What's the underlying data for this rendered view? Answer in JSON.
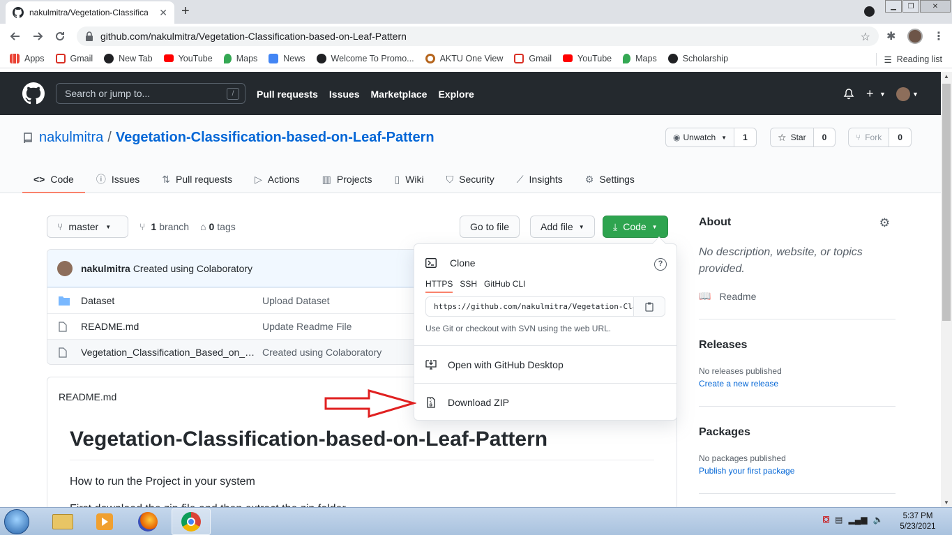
{
  "browser": {
    "tab_title": "nakulmitra/Vegetation-Classification-based-on-Leaf-Pattern",
    "tab_close": "✕",
    "new_tab": "+",
    "url": "github.com/nakulmitra/Vegetation-Classification-based-on-Leaf-Pattern",
    "bookmarks": [
      {
        "label": "Apps",
        "icon": "apps-grid-icon",
        "color": "#4285f4"
      },
      {
        "label": "Gmail",
        "icon": "gmail-icon",
        "color": "#d93025"
      },
      {
        "label": "New Tab",
        "icon": "globe-icon",
        "color": "#202124"
      },
      {
        "label": "YouTube",
        "icon": "youtube-icon",
        "color": "#ff0000"
      },
      {
        "label": "Maps",
        "icon": "maps-icon",
        "color": "#34a853"
      },
      {
        "label": "News",
        "icon": "news-icon",
        "color": "#4285f4"
      },
      {
        "label": "Welcome To Promo...",
        "icon": "globe-icon",
        "color": "#202124"
      },
      {
        "label": "AKTU One View",
        "icon": "seal-icon",
        "color": "#b5651d"
      },
      {
        "label": "Gmail",
        "icon": "gmail-icon",
        "color": "#d93025"
      },
      {
        "label": "YouTube",
        "icon": "youtube-icon",
        "color": "#ff0000"
      },
      {
        "label": "Maps",
        "icon": "maps-icon",
        "color": "#34a853"
      },
      {
        "label": "Scholarship",
        "icon": "globe-icon",
        "color": "#202124"
      }
    ],
    "reading_list": "Reading list"
  },
  "github_header": {
    "search_placeholder": "Search or jump to...",
    "search_shortcut": "/",
    "nav": [
      "Pull requests",
      "Issues",
      "Marketplace",
      "Explore"
    ]
  },
  "repo": {
    "owner": "nakulmitra",
    "separator": "/",
    "name": "Vegetation-Classification-based-on-Leaf-Pattern",
    "watch_label": "Unwatch",
    "watch_count": "1",
    "star_label": "Star",
    "star_count": "0",
    "fork_label": "Fork",
    "fork_count": "0",
    "tabs": [
      {
        "label": "Code",
        "icon": "code-icon"
      },
      {
        "label": "Issues",
        "icon": "issue-icon"
      },
      {
        "label": "Pull requests",
        "icon": "pull-request-icon"
      },
      {
        "label": "Actions",
        "icon": "play-icon"
      },
      {
        "label": "Projects",
        "icon": "project-icon"
      },
      {
        "label": "Wiki",
        "icon": "book-icon"
      },
      {
        "label": "Security",
        "icon": "shield-icon"
      },
      {
        "label": "Insights",
        "icon": "graph-icon"
      },
      {
        "label": "Settings",
        "icon": "gear-icon"
      }
    ]
  },
  "toolbar": {
    "branch": "master",
    "branch_count": "1",
    "branch_word": "branch",
    "tag_count": "0",
    "tag_word": "tags",
    "go_to_file": "Go to file",
    "add_file": "Add file",
    "code": "Code"
  },
  "commit": {
    "author": "nakulmitra",
    "message": "Created using Colaboratory"
  },
  "files": [
    {
      "name": "Dataset",
      "message": "Upload Dataset",
      "type": "folder"
    },
    {
      "name": "README.md",
      "message": "Update Readme File",
      "type": "file"
    },
    {
      "name": "Vegetation_Classification_Based_on_L...",
      "message": "Created using Colaboratory",
      "type": "file"
    }
  ],
  "readme": {
    "filename": "README.md",
    "heading": "Vegetation-Classification-based-on-Leaf-Pattern",
    "p1": "How to run the Project in your system",
    "p2": "First download the zip file and then extract the zip folder"
  },
  "clone_dropdown": {
    "title": "Clone",
    "help": "?",
    "protocols": [
      "HTTPS",
      "SSH",
      "GitHub CLI"
    ],
    "url": "https://github.com/nakulmitra/Vegetation-Classification-based-on-Leaf-Pattern.git",
    "hint": "Use Git or checkout with SVN using the web URL.",
    "open_desktop": "Open with GitHub Desktop",
    "download_zip": "Download ZIP"
  },
  "sidebar": {
    "about_title": "About",
    "about_text": "No description, website, or topics provided.",
    "readme_link": "Readme",
    "releases_title": "Releases",
    "releases_text": "No releases published",
    "releases_link": "Create a new release",
    "packages_title": "Packages",
    "packages_text": "No packages published",
    "packages_link": "Publish your first package"
  },
  "taskbar": {
    "time": "5:37 PM",
    "date": "5/23/2021"
  },
  "colors": {
    "github_header": "#24292e",
    "link_blue": "#0366d6",
    "code_button_green": "#2ea44f",
    "tab_underline": "#f9826c",
    "annotation_arrow": "#e02020"
  }
}
